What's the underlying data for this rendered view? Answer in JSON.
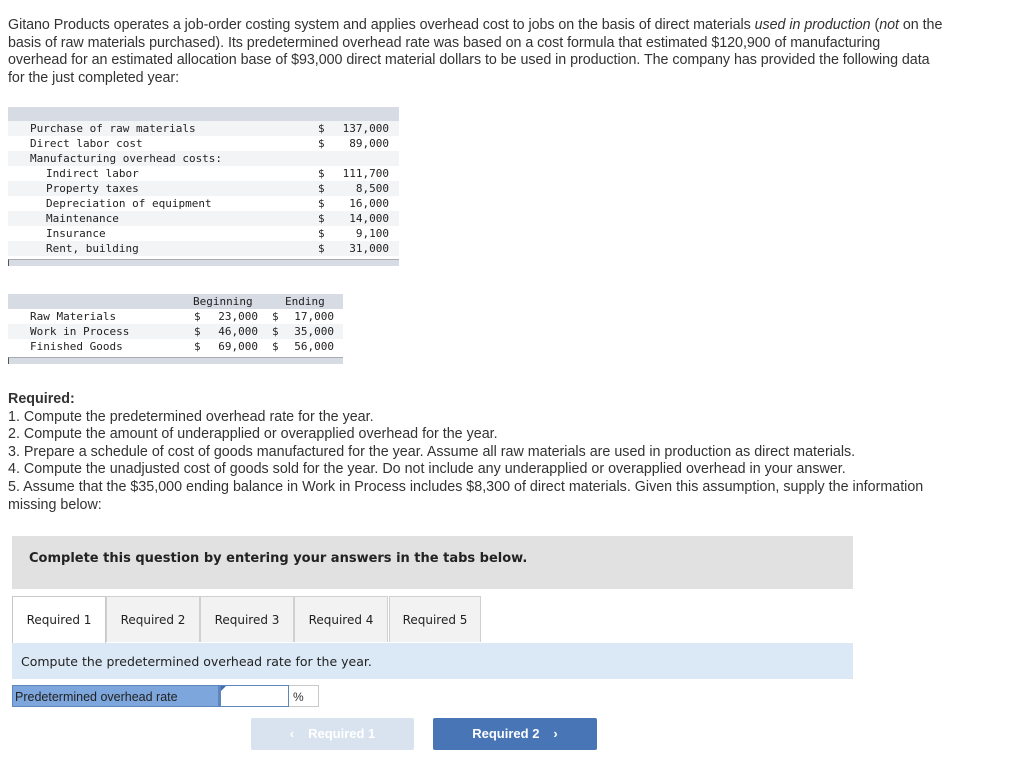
{
  "intro": {
    "p1": "Gitano Products operates a job-order costing system and applies overhead cost to jobs on the basis of direct materials ",
    "p1_italic": "used in production",
    "p2": " (",
    "p2_italic": "not",
    "p3": " on the basis of raw materials purchased). Its predetermined overhead rate was based on a cost formula that estimated $120,900 of manufacturing overhead for an estimated allocation base of $93,000 direct material dollars to be used in production. The company has provided the following data for the just completed year:"
  },
  "cost_table": {
    "rows": [
      {
        "label": "Purchase of raw materials",
        "dollar": "$",
        "amount": "137,000",
        "indent": false
      },
      {
        "label": "Direct labor cost",
        "dollar": "$",
        "amount": "89,000",
        "indent": false
      },
      {
        "label": "Manufacturing overhead costs:",
        "dollar": "",
        "amount": "",
        "indent": false
      },
      {
        "label": "Indirect labor",
        "dollar": "$",
        "amount": "111,700",
        "indent": true
      },
      {
        "label": "Property taxes",
        "dollar": "$",
        "amount": "8,500",
        "indent": true
      },
      {
        "label": "Depreciation of equipment",
        "dollar": "$",
        "amount": "16,000",
        "indent": true
      },
      {
        "label": "Maintenance",
        "dollar": "$",
        "amount": "14,000",
        "indent": true
      },
      {
        "label": "Insurance",
        "dollar": "$",
        "amount": "9,100",
        "indent": true
      },
      {
        "label": "Rent, building",
        "dollar": "$",
        "amount": "31,000",
        "indent": true
      }
    ]
  },
  "inventory_table": {
    "headers": {
      "beginning": "Beginning",
      "ending": "Ending"
    },
    "rows": [
      {
        "label": "Raw Materials",
        "beginning": "23,000",
        "ending": "17,000"
      },
      {
        "label": "Work in Process",
        "beginning": "46,000",
        "ending": "35,000"
      },
      {
        "label": "Finished Goods",
        "beginning": "69,000",
        "ending": "56,000"
      }
    ],
    "dollar": "$"
  },
  "required": {
    "heading": "Required:",
    "items": [
      "1. Compute the predetermined overhead rate for the year.",
      "2. Compute the amount of underapplied or overapplied overhead for the year.",
      "3. Prepare a schedule of cost of goods manufactured for the year. Assume all raw materials are used in production as direct materials.",
      "4. Compute the unadjusted cost of goods sold for the year. Do not include any underapplied or overapplied overhead in your answer.",
      "5. Assume that the $35,000 ending balance in Work in Process includes $8,300 of direct materials. Given this assumption, supply the information missing below:"
    ]
  },
  "banner": "Complete this question by entering your answers in the tabs below.",
  "tabs": [
    {
      "label": "Required 1",
      "active": true
    },
    {
      "label": "Required 2",
      "active": false
    },
    {
      "label": "Required 3",
      "active": false
    },
    {
      "label": "Required 4",
      "active": false
    },
    {
      "label": "Required 5",
      "active": false
    }
  ],
  "prompt": "Compute the predetermined overhead rate for the year.",
  "answer": {
    "label": "Predetermined overhead rate",
    "value": "",
    "unit": "%"
  },
  "nav": {
    "prev_label": "Required 1",
    "prev_icon": "‹",
    "next_label": "Required 2",
    "next_icon": "›"
  }
}
